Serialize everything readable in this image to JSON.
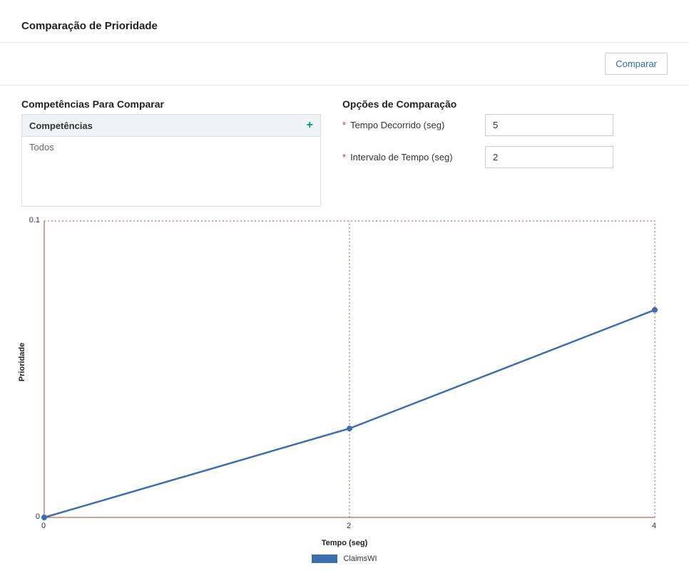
{
  "header": {
    "title": "Comparação de Prioridade"
  },
  "actions": {
    "compare": "Comparar"
  },
  "left": {
    "title": "Competências Para Comparar",
    "grid_header": "Competências",
    "rows": [
      "Todos"
    ]
  },
  "right": {
    "title": "Opções de Comparação",
    "fields": [
      {
        "label": "Tempo Decorrido (seg)",
        "value": "5"
      },
      {
        "label": "Intervalo de Tempo (seg)",
        "value": "2"
      }
    ]
  },
  "chart_data": {
    "type": "line",
    "title": "",
    "xlabel": "Tempo (seg)",
    "ylabel": "Prioridade",
    "xlim": [
      0,
      4
    ],
    "ylim": [
      0,
      0.1
    ],
    "x_ticks": [
      0,
      2,
      4
    ],
    "y_ticks": [
      0,
      0.1
    ],
    "series": [
      {
        "name": "ClaimsWI",
        "x": [
          0,
          2,
          4
        ],
        "y": [
          0,
          0.03,
          0.07
        ],
        "color": "#3b6fb0"
      }
    ]
  }
}
